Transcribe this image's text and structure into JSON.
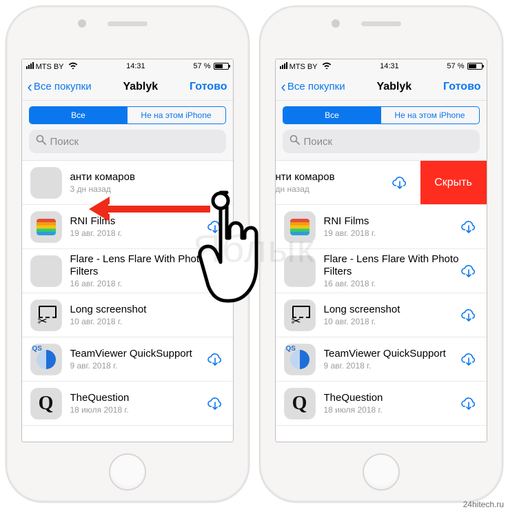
{
  "statusbar": {
    "carrier": "MTS BY",
    "time": "14:31",
    "battery_pct": "57 %"
  },
  "nav": {
    "back": "Все покупки",
    "title": "Yablyk",
    "done": "Готово"
  },
  "tabs": {
    "all": "Все",
    "not_on_device": "Не на этом iPhone"
  },
  "search": {
    "placeholder": "Поиск"
  },
  "hide_button": "Скрыть",
  "apps": [
    {
      "name": "анти комаров",
      "date": "3 дн назад",
      "cloud": false,
      "icon": "ic-anti"
    },
    {
      "name": "RNI Films",
      "date": "19 авг. 2018 г.",
      "cloud": true,
      "icon": "ic-rni"
    },
    {
      "name": "Flare - Lens Flare With Photo Filters",
      "date": "16 авг. 2018 г.",
      "cloud": true,
      "icon": "ic-flare",
      "twoLine": true
    },
    {
      "name": "Long screenshot",
      "date": "10 авг. 2018 г.",
      "cloud": false,
      "icon": "ic-long"
    },
    {
      "name": "TeamViewer QuickSupport",
      "date": "9 авг. 2018 г.",
      "cloud": true,
      "icon": "ic-tv"
    },
    {
      "name": "TheQuestion",
      "date": "18 июля 2018 г.",
      "cloud": true,
      "icon": "ic-q"
    }
  ],
  "apps_swiped": [
    {
      "name": "нти комаров",
      "date": "дн назад",
      "cloud": true,
      "swiped": true
    },
    {
      "name": "RNI Films",
      "date": "19 авг. 2018 г.",
      "cloud": true,
      "icon": "ic-rni"
    },
    {
      "name": "Flare - Lens Flare With Photo Filters",
      "date": "16 авг. 2018 г.",
      "cloud": true,
      "icon": "ic-flare",
      "twoLine": true
    },
    {
      "name": "Long screenshot",
      "date": "10 авг. 2018 г.",
      "cloud": true,
      "icon": "ic-long"
    },
    {
      "name": "TeamViewer QuickSupport",
      "date": "9 авг. 2018 г.",
      "cloud": true,
      "icon": "ic-tv"
    },
    {
      "name": "TheQuestion",
      "date": "18 июля 2018 г.",
      "cloud": true,
      "icon": "ic-q"
    }
  ],
  "watermark": "Яблык",
  "source": "24hitech.ru"
}
